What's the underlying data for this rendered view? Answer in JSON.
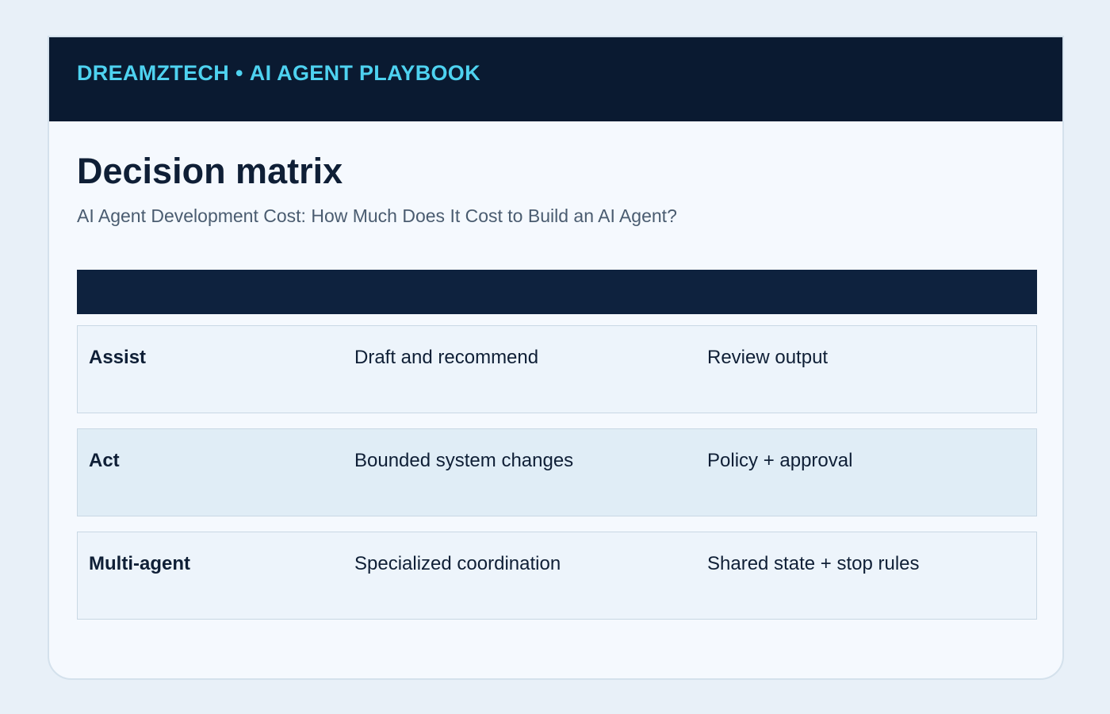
{
  "header": {
    "brand": "DREAMZTECH",
    "separator": "•",
    "section": "AI AGENT PLAYBOOK"
  },
  "page": {
    "title": "Decision matrix",
    "subtitle": "AI Agent Development Cost: How Much Does It Cost to Build an AI Agent?"
  },
  "table": {
    "rows": [
      [
        "Assist",
        "Draft and recommend",
        "Review output"
      ],
      [
        "Act",
        "Bounded system changes",
        "Policy + approval"
      ],
      [
        "Multi-agent",
        "Specialized coordination",
        "Shared state + stop rules"
      ]
    ]
  },
  "colors": {
    "banner_bg": "#0a1a31",
    "accent": "#4ed2f0",
    "table_header_bg": "#0e223e",
    "row_bg": "#edf4fb",
    "row_alt_bg": "#e0edf6"
  }
}
